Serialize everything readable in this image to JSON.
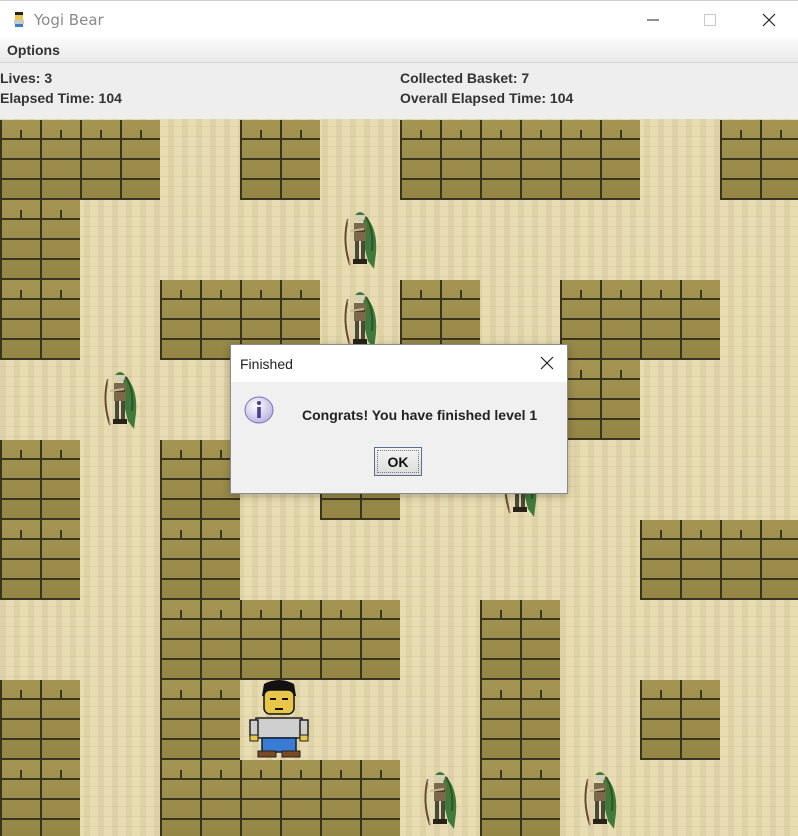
{
  "window": {
    "title": "Yogi Bear",
    "app_icon": "yogi-bear-icon",
    "controls": [
      "minimize-icon",
      "maximize-icon",
      "close-icon"
    ]
  },
  "menubar": {
    "options_label": "Options"
  },
  "status": {
    "lives": "Lives: 3",
    "elapsed_time": "Elapsed Time: 104",
    "collected_basket": "Collected Basket: 7",
    "overall_elapsed_time": "Overall Elapsed Time: 104"
  },
  "board": {
    "colors": {
      "floor": "#e8ddb2",
      "brick": "#9c8e4b",
      "mortar": "#3a3520"
    },
    "tiles": [
      "wall",
      "floor",
      "player",
      "ranger"
    ]
  },
  "dialog": {
    "title": "Finished",
    "message": "Congrats! You have finished level 1",
    "ok_label": "OK",
    "icon": "info-icon"
  }
}
